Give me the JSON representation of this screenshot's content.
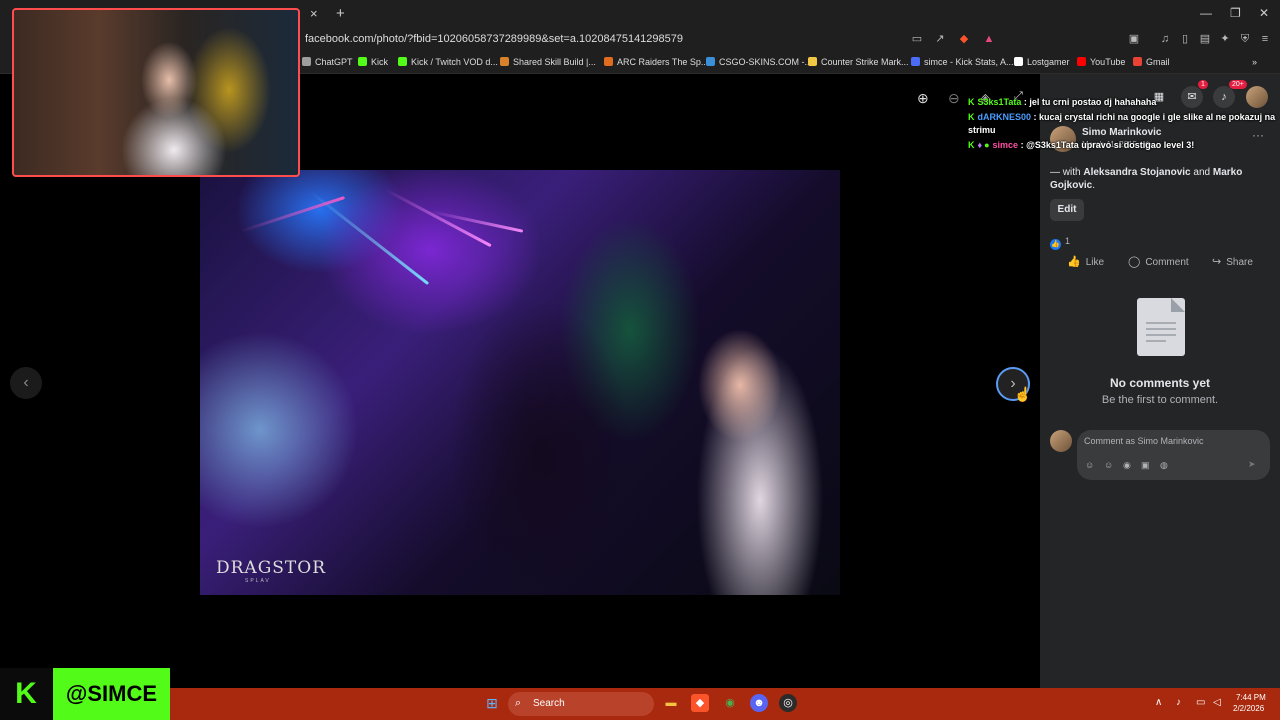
{
  "browser": {
    "tab_close": "×",
    "tab_new": "+",
    "url": "facebook.com/photo/?fbid=10206058737289989&set=a.10208475141298579",
    "bookmarks": [
      {
        "label": "ChatGPT",
        "color": "#9e9e9e"
      },
      {
        "label": "Kick",
        "color": "#53fc18"
      },
      {
        "label": "Kick / Twitch VOD d...",
        "color": "#53fc18"
      },
      {
        "label": "Shared Skill Build |...",
        "color": "#d9822b"
      },
      {
        "label": "ARC Raiders The Sp...",
        "color": "#e06c1f"
      },
      {
        "label": "CSGO-SKINS.COM -...",
        "color": "#3b8ed8"
      },
      {
        "label": "Counter Strike Mark...",
        "color": "#f2c744"
      },
      {
        "label": "simce - Kick Stats, A...",
        "color": "#4a6cf7"
      },
      {
        "label": "Lostgamer",
        "color": "#ffffff"
      },
      {
        "label": "YouTube",
        "color": "#ff0000"
      },
      {
        "label": "Gmail",
        "color": "#ea4335"
      }
    ],
    "bookmarks_overflow": "»"
  },
  "viewer": {
    "prev_glyph": "‹",
    "next_glyph": "›",
    "watermark": "DRAGSTOR",
    "watermark_sub": "SPLAV"
  },
  "chat": [
    {
      "user": "S3ks1Tata",
      "message": ": jel tu crni postao dj hahahaha",
      "user_color": "#53fc18"
    },
    {
      "user": "dARKNES00",
      "message": ": kucaj crystal richi na google i gle slike al ne pokazuj na strimu",
      "user_color": "#4a9cff"
    },
    {
      "user": "simce",
      "message": ": @S3ks1Tata upravo si dostigao level 3!",
      "user_color": "#ff4fa3"
    }
  ],
  "post": {
    "author": "Simo Marinkovic",
    "date": "March 11, 2015 · ",
    "with_prefix": "— with ",
    "tag1": "Aleksandra Stojanovic",
    "and": " and ",
    "tag2": "Marko Gojkovic",
    "with_suffix": ".",
    "edit_label": "Edit",
    "like_count": "1",
    "like_label": "Like",
    "comment_label": "Comment",
    "share_label": "Share",
    "no_comments_title": "No comments yet",
    "no_comments_sub": "Be the first to comment.",
    "comment_placeholder": "Comment as Simo Marinkovic"
  },
  "header_icons": {
    "notification_badge_1": "1",
    "notification_badge_20": "20+"
  },
  "streamer": {
    "kick_logo": "K",
    "handle": "@SIMCE"
  },
  "taskbar": {
    "search_label": "Search",
    "time": "7:44 PM",
    "date": "2/2/2026"
  },
  "colors": {
    "accent_kick": "#53fc18",
    "facebook_blue": "#1877f2",
    "taskbar": "#a8290d"
  }
}
